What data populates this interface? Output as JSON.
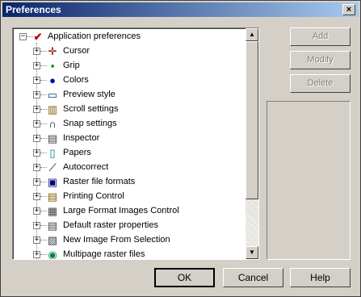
{
  "window": {
    "title": "Preferences",
    "close_label": "×"
  },
  "tree": {
    "root": {
      "label": "Application preferences",
      "expander": "−",
      "icon": "checkmark-icon"
    },
    "items": [
      {
        "label": "Cursor",
        "icon": "cursor-icon",
        "glyph": "✛",
        "color": "#800000"
      },
      {
        "label": "Grip",
        "icon": "grip-icon",
        "glyph": "▪",
        "color": "#008000"
      },
      {
        "label": "Colors",
        "icon": "colors-icon",
        "glyph": "●",
        "color": "#0000c0"
      },
      {
        "label": "Preview style",
        "icon": "preview-icon",
        "glyph": "▭",
        "color": "#004080"
      },
      {
        "label": "Scroll settings",
        "icon": "scroll-icon",
        "glyph": "▥",
        "color": "#806000"
      },
      {
        "label": "Snap settings",
        "icon": "magnet-icon",
        "glyph": "∩",
        "color": "#000000"
      },
      {
        "label": "Inspector",
        "icon": "inspector-icon",
        "glyph": "▤",
        "color": "#404040"
      },
      {
        "label": "Papers",
        "icon": "papers-icon",
        "glyph": "▯",
        "color": "#008080"
      },
      {
        "label": "Autocorrect",
        "icon": "autocorrect-icon",
        "glyph": "⟋",
        "color": "#000000"
      },
      {
        "label": "Raster file formats",
        "icon": "floppy-icon",
        "glyph": "▣",
        "color": "#000080"
      },
      {
        "label": "Printing Control",
        "icon": "printing-icon",
        "glyph": "▤",
        "color": "#806000"
      },
      {
        "label": "Large Format Images Control",
        "icon": "large-format-icon",
        "glyph": "▦",
        "color": "#404040"
      },
      {
        "label": "Default raster properties",
        "icon": "raster-props-icon",
        "glyph": "▤",
        "color": "#404040"
      },
      {
        "label": "New Image From Selection",
        "icon": "new-image-icon",
        "glyph": "▧",
        "color": "#404040"
      },
      {
        "label": "Multipage raster files",
        "icon": "globe-icon",
        "glyph": "◉",
        "color": "#008040"
      }
    ],
    "expander_collapsed": "+"
  },
  "side_buttons": {
    "add": "Add",
    "modify": "Modify",
    "delete": "Delete"
  },
  "buttons": {
    "ok": "OK",
    "cancel": "Cancel",
    "help": "Help"
  },
  "scrollbar": {
    "up": "▲",
    "down": "▼"
  }
}
